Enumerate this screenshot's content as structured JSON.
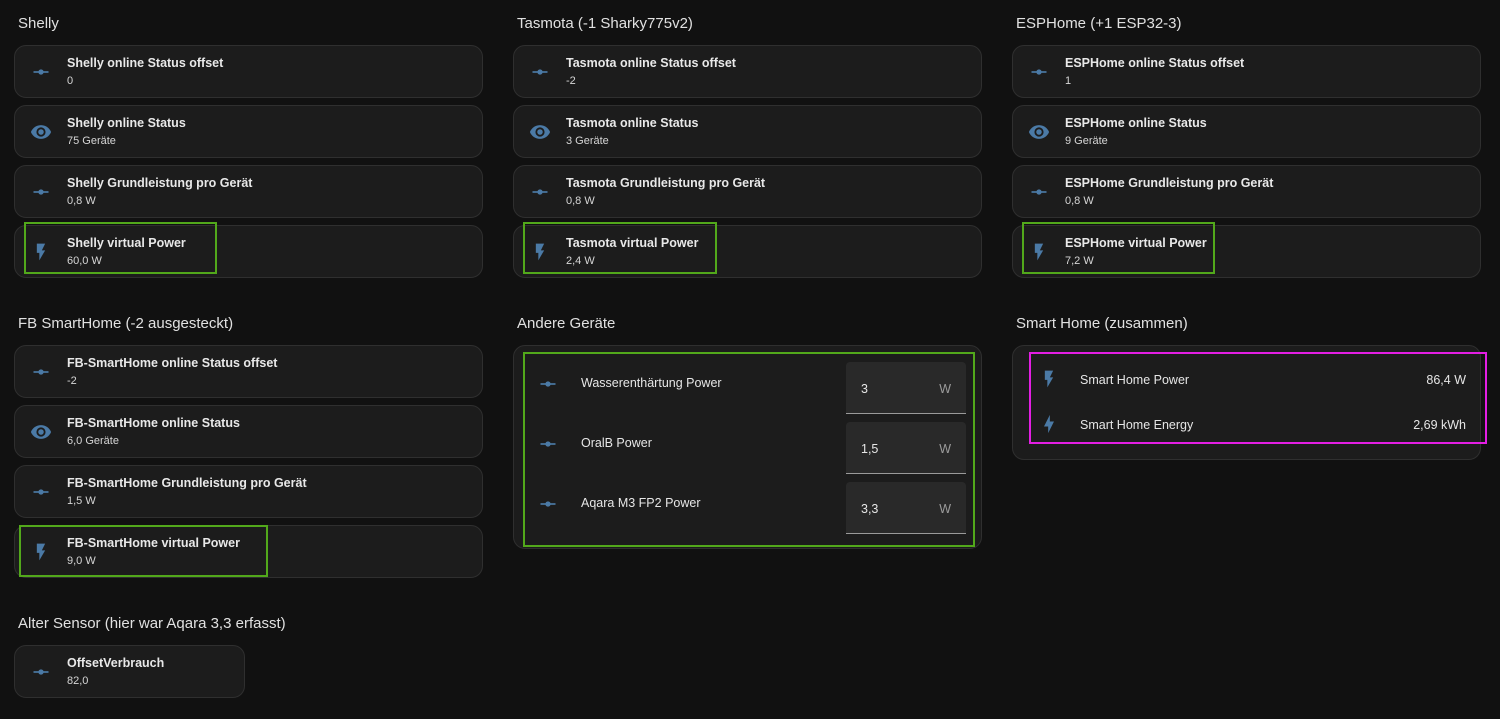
{
  "colors": {
    "icon": "#4b7aa6",
    "highlight_green": "#52a81b",
    "highlight_pink": "#e31ee3",
    "background": "#111111",
    "card": "#1c1c1c"
  },
  "shelly": {
    "title": "Shelly",
    "tiles": [
      {
        "name": "Shelly online Status offset",
        "state": "0",
        "icon": "slider-icon"
      },
      {
        "name": "Shelly online Status",
        "state": "75 Geräte",
        "icon": "eye-icon"
      },
      {
        "name": "Shelly Grundleistung pro Gerät",
        "state": "0,8 W",
        "icon": "slider-icon"
      },
      {
        "name": "Shelly virtual Power",
        "state": "60,0 W",
        "icon": "flash-icon"
      }
    ]
  },
  "tasmota": {
    "title": "Tasmota (-1 Sharky775v2)",
    "tiles": [
      {
        "name": "Tasmota online Status offset",
        "state": "-2",
        "icon": "slider-icon"
      },
      {
        "name": "Tasmota online Status",
        "state": "3 Geräte",
        "icon": "eye-icon"
      },
      {
        "name": "Tasmota Grundleistung pro Gerät",
        "state": "0,8 W",
        "icon": "slider-icon"
      },
      {
        "name": "Tasmota virtual Power",
        "state": "2,4 W",
        "icon": "flash-icon"
      }
    ]
  },
  "esphome": {
    "title": "ESPHome (+1 ESP32-3)",
    "tiles": [
      {
        "name": "ESPHome online Status offset",
        "state": "1",
        "icon": "slider-icon"
      },
      {
        "name": "ESPHome online Status",
        "state": "9 Geräte",
        "icon": "eye-icon"
      },
      {
        "name": "ESPHome Grundleistung pro Gerät",
        "state": "0,8 W",
        "icon": "slider-icon"
      },
      {
        "name": "ESPHome virtual Power",
        "state": "7,2 W",
        "icon": "flash-icon"
      }
    ]
  },
  "fb": {
    "title": "FB SmartHome (-2 ausgesteckt)",
    "tiles": [
      {
        "name": "FB-SmartHome online Status offset",
        "state": "-2",
        "icon": "slider-icon"
      },
      {
        "name": "FB-SmartHome online Status",
        "state": "6,0 Geräte",
        "icon": "eye-icon"
      },
      {
        "name": "FB-SmartHome Grundleistung pro Gerät",
        "state": "1,5 W",
        "icon": "slider-icon"
      },
      {
        "name": "FB-SmartHome virtual Power",
        "state": "9,0 W",
        "icon": "flash-icon"
      }
    ]
  },
  "andere": {
    "title": "Andere Geräte",
    "rows": [
      {
        "label": "Wasserenthärtung Power",
        "value": "3",
        "unit": "W",
        "icon": "slider-icon"
      },
      {
        "label": "OralB Power",
        "value": "1,5",
        "unit": "W",
        "icon": "slider-icon"
      },
      {
        "label": "Aqara M3 FP2 Power",
        "value": "3,3",
        "unit": "W",
        "icon": "slider-icon"
      }
    ]
  },
  "smart_home": {
    "title": "Smart Home (zusammen)",
    "rows": [
      {
        "label": "Smart Home Power",
        "value": "86,4 W",
        "icon": "flash-icon"
      },
      {
        "label": "Smart Home Energy",
        "value": "2,69 kWh",
        "icon": "lightning-bolt-icon"
      }
    ]
  },
  "alter": {
    "title": "Alter Sensor (hier war Aqara 3,3 erfasst)",
    "tiles": [
      {
        "name": "OffsetVerbrauch",
        "state": "82,0",
        "icon": "slider-icon"
      }
    ]
  }
}
